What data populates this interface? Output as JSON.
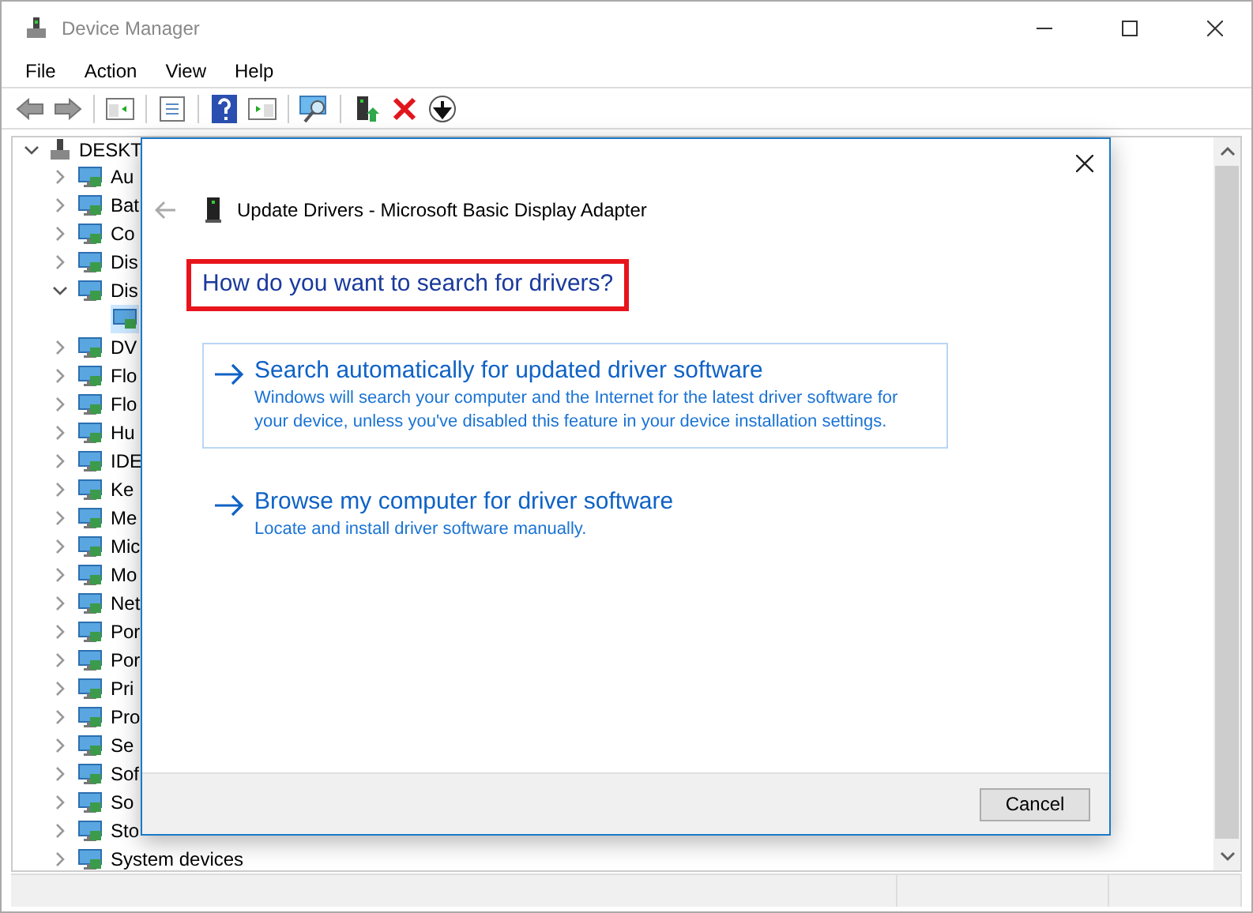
{
  "window": {
    "title": "Device Manager"
  },
  "menu": [
    "File",
    "Action",
    "View",
    "Help"
  ],
  "tree": {
    "label": "DESKT",
    "expanded": true,
    "children": [
      {
        "label": "Au",
        "expanded": false,
        "selected": false
      },
      {
        "label": "Bat",
        "expanded": false,
        "selected": false
      },
      {
        "label": "Co",
        "expanded": false,
        "selected": false
      },
      {
        "label": "Dis",
        "expanded": false,
        "selected": false
      },
      {
        "label": "Dis",
        "expanded": true,
        "selected": false,
        "children": [
          {
            "selected": true
          }
        ]
      },
      {
        "label": "DV",
        "expanded": false,
        "selected": false
      },
      {
        "label": "Flo",
        "expanded": false,
        "selected": false
      },
      {
        "label": "Flo",
        "expanded": false,
        "selected": false
      },
      {
        "label": "Hu",
        "expanded": false,
        "selected": false
      },
      {
        "label": "IDE",
        "expanded": false,
        "selected": false
      },
      {
        "label": "Ke",
        "expanded": false,
        "selected": false
      },
      {
        "label": "Me",
        "expanded": false,
        "selected": false
      },
      {
        "label": "Mic",
        "expanded": false,
        "selected": false
      },
      {
        "label": "Mo",
        "expanded": false,
        "selected": false
      },
      {
        "label": "Net",
        "expanded": false,
        "selected": false
      },
      {
        "label": "Por",
        "expanded": false,
        "selected": false
      },
      {
        "label": "Por",
        "expanded": false,
        "selected": false
      },
      {
        "label": "Pri",
        "expanded": false,
        "selected": false
      },
      {
        "label": "Pro",
        "expanded": false,
        "selected": false
      },
      {
        "label": "Se",
        "expanded": false,
        "selected": false
      },
      {
        "label": "Sof",
        "expanded": false,
        "selected": false
      },
      {
        "label": "So",
        "expanded": false,
        "selected": false
      },
      {
        "label": "Sto",
        "expanded": false,
        "selected": false
      },
      {
        "label": "System devices",
        "expanded": false,
        "selected": false
      }
    ]
  },
  "dialog": {
    "title": "Update Drivers - Microsoft Basic Display Adapter",
    "heading": "How do you want to search for drivers?",
    "options": [
      {
        "title": "Search automatically for updated driver software",
        "description": "Windows will search your computer and the Internet for the latest driver software for your device, unless you've disabled this feature in your device installation settings.",
        "focused": true
      },
      {
        "title": "Browse my computer for driver software",
        "description": "Locate and install driver software manually.",
        "focused": false
      }
    ],
    "buttons": [
      "Cancel"
    ]
  }
}
